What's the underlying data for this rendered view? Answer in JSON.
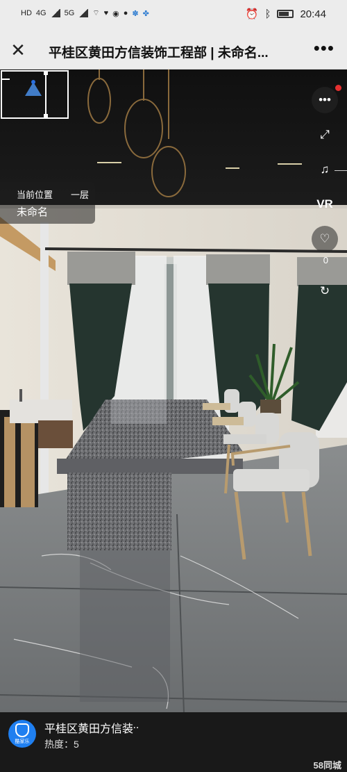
{
  "status_bar": {
    "network_left": "4G",
    "network_right": "5G",
    "time": "20:44"
  },
  "title_bar": {
    "title": "平桂区黄田方信装饰工程部 | 未命名...",
    "close_icon": "close-icon",
    "more_icon": "more-icon"
  },
  "location": {
    "label": "当前位置",
    "floor": "一层",
    "name": "未命名"
  },
  "right_controls": {
    "more_label": "•••",
    "vr_label": "VR",
    "like_count": "0"
  },
  "footer": {
    "shop_name": "平桂区黄田方信装",
    "ellipsis": "...",
    "heat": "热度：5",
    "avatar_text": "酷家乐",
    "brand": "58同城"
  },
  "colors": {
    "status_bg": "#ececec",
    "accent_red": "#e53030",
    "avatar_blue": "#1f7ff0"
  }
}
